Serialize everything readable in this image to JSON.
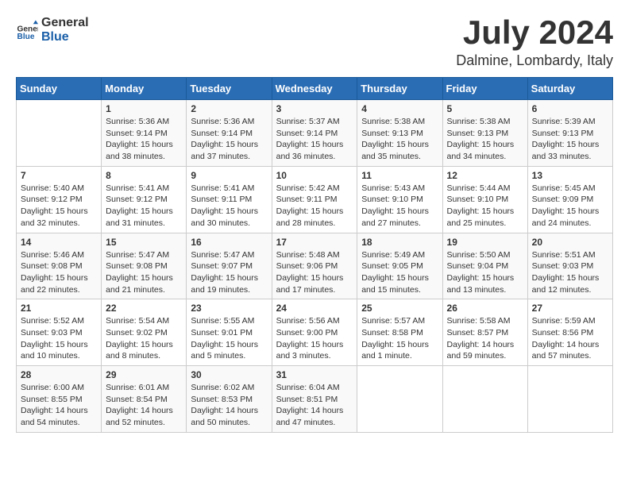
{
  "logo": {
    "general": "General",
    "blue": "Blue"
  },
  "title": {
    "month_year": "July 2024",
    "location": "Dalmine, Lombardy, Italy"
  },
  "calendar": {
    "headers": [
      "Sunday",
      "Monday",
      "Tuesday",
      "Wednesday",
      "Thursday",
      "Friday",
      "Saturday"
    ],
    "rows": [
      [
        {
          "day": "",
          "info": ""
        },
        {
          "day": "1",
          "info": "Sunrise: 5:36 AM\nSunset: 9:14 PM\nDaylight: 15 hours\nand 38 minutes."
        },
        {
          "day": "2",
          "info": "Sunrise: 5:36 AM\nSunset: 9:14 PM\nDaylight: 15 hours\nand 37 minutes."
        },
        {
          "day": "3",
          "info": "Sunrise: 5:37 AM\nSunset: 9:14 PM\nDaylight: 15 hours\nand 36 minutes."
        },
        {
          "day": "4",
          "info": "Sunrise: 5:38 AM\nSunset: 9:13 PM\nDaylight: 15 hours\nand 35 minutes."
        },
        {
          "day": "5",
          "info": "Sunrise: 5:38 AM\nSunset: 9:13 PM\nDaylight: 15 hours\nand 34 minutes."
        },
        {
          "day": "6",
          "info": "Sunrise: 5:39 AM\nSunset: 9:13 PM\nDaylight: 15 hours\nand 33 minutes."
        }
      ],
      [
        {
          "day": "7",
          "info": "Sunrise: 5:40 AM\nSunset: 9:12 PM\nDaylight: 15 hours\nand 32 minutes."
        },
        {
          "day": "8",
          "info": "Sunrise: 5:41 AM\nSunset: 9:12 PM\nDaylight: 15 hours\nand 31 minutes."
        },
        {
          "day": "9",
          "info": "Sunrise: 5:41 AM\nSunset: 9:11 PM\nDaylight: 15 hours\nand 30 minutes."
        },
        {
          "day": "10",
          "info": "Sunrise: 5:42 AM\nSunset: 9:11 PM\nDaylight: 15 hours\nand 28 minutes."
        },
        {
          "day": "11",
          "info": "Sunrise: 5:43 AM\nSunset: 9:10 PM\nDaylight: 15 hours\nand 27 minutes."
        },
        {
          "day": "12",
          "info": "Sunrise: 5:44 AM\nSunset: 9:10 PM\nDaylight: 15 hours\nand 25 minutes."
        },
        {
          "day": "13",
          "info": "Sunrise: 5:45 AM\nSunset: 9:09 PM\nDaylight: 15 hours\nand 24 minutes."
        }
      ],
      [
        {
          "day": "14",
          "info": "Sunrise: 5:46 AM\nSunset: 9:08 PM\nDaylight: 15 hours\nand 22 minutes."
        },
        {
          "day": "15",
          "info": "Sunrise: 5:47 AM\nSunset: 9:08 PM\nDaylight: 15 hours\nand 21 minutes."
        },
        {
          "day": "16",
          "info": "Sunrise: 5:47 AM\nSunset: 9:07 PM\nDaylight: 15 hours\nand 19 minutes."
        },
        {
          "day": "17",
          "info": "Sunrise: 5:48 AM\nSunset: 9:06 PM\nDaylight: 15 hours\nand 17 minutes."
        },
        {
          "day": "18",
          "info": "Sunrise: 5:49 AM\nSunset: 9:05 PM\nDaylight: 15 hours\nand 15 minutes."
        },
        {
          "day": "19",
          "info": "Sunrise: 5:50 AM\nSunset: 9:04 PM\nDaylight: 15 hours\nand 13 minutes."
        },
        {
          "day": "20",
          "info": "Sunrise: 5:51 AM\nSunset: 9:03 PM\nDaylight: 15 hours\nand 12 minutes."
        }
      ],
      [
        {
          "day": "21",
          "info": "Sunrise: 5:52 AM\nSunset: 9:03 PM\nDaylight: 15 hours\nand 10 minutes."
        },
        {
          "day": "22",
          "info": "Sunrise: 5:54 AM\nSunset: 9:02 PM\nDaylight: 15 hours\nand 8 minutes."
        },
        {
          "day": "23",
          "info": "Sunrise: 5:55 AM\nSunset: 9:01 PM\nDaylight: 15 hours\nand 5 minutes."
        },
        {
          "day": "24",
          "info": "Sunrise: 5:56 AM\nSunset: 9:00 PM\nDaylight: 15 hours\nand 3 minutes."
        },
        {
          "day": "25",
          "info": "Sunrise: 5:57 AM\nSunset: 8:58 PM\nDaylight: 15 hours\nand 1 minute."
        },
        {
          "day": "26",
          "info": "Sunrise: 5:58 AM\nSunset: 8:57 PM\nDaylight: 14 hours\nand 59 minutes."
        },
        {
          "day": "27",
          "info": "Sunrise: 5:59 AM\nSunset: 8:56 PM\nDaylight: 14 hours\nand 57 minutes."
        }
      ],
      [
        {
          "day": "28",
          "info": "Sunrise: 6:00 AM\nSunset: 8:55 PM\nDaylight: 14 hours\nand 54 minutes."
        },
        {
          "day": "29",
          "info": "Sunrise: 6:01 AM\nSunset: 8:54 PM\nDaylight: 14 hours\nand 52 minutes."
        },
        {
          "day": "30",
          "info": "Sunrise: 6:02 AM\nSunset: 8:53 PM\nDaylight: 14 hours\nand 50 minutes."
        },
        {
          "day": "31",
          "info": "Sunrise: 6:04 AM\nSunset: 8:51 PM\nDaylight: 14 hours\nand 47 minutes."
        },
        {
          "day": "",
          "info": ""
        },
        {
          "day": "",
          "info": ""
        },
        {
          "day": "",
          "info": ""
        }
      ]
    ]
  }
}
